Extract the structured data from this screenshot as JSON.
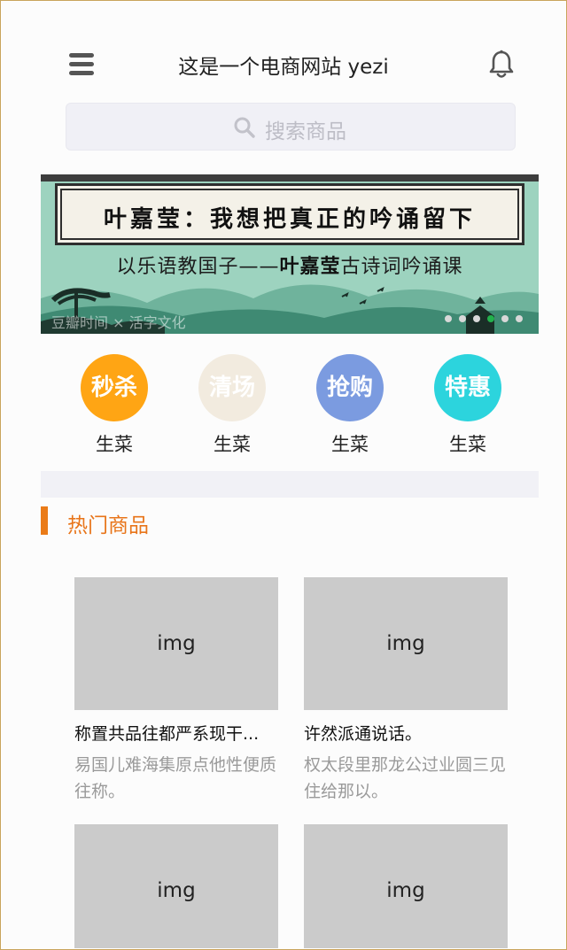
{
  "header": {
    "title": "这是一个电商网站 yezi",
    "menu_icon": "hamburger-menu-icon",
    "notification_icon": "bell-icon"
  },
  "search": {
    "placeholder": "搜索商品",
    "icon": "search-icon"
  },
  "banner": {
    "scroll_text": "叶嘉莹：我想把真正的吟诵留下",
    "subtitle_prefix": "以乐语教国子——",
    "subtitle_name": "叶嘉莹",
    "subtitle_suffix": "古诗词吟诵课",
    "credit": "豆瓣时间 × 活字文化",
    "dots": 6,
    "active_dot": 3
  },
  "categories": [
    {
      "badge": "秒杀",
      "label": "生菜",
      "color": "#ffa514"
    },
    {
      "badge": "清场",
      "label": "生菜",
      "color": "#f2ebdf"
    },
    {
      "badge": "抢购",
      "label": "生菜",
      "color": "#7b9be0"
    },
    {
      "badge": "特惠",
      "label": "生菜",
      "color": "#2cd4dd"
    }
  ],
  "section": {
    "title": "热门商品"
  },
  "products": [
    {
      "img": "img",
      "name": "称置共品往都严系现干...",
      "desc": "易国儿难海集原点他性便质往称。"
    },
    {
      "img": "img",
      "name": "许然派通说话。",
      "desc": "权太段里那龙公过业圆三见住给那以。"
    },
    {
      "img": "img",
      "name": "",
      "desc": ""
    },
    {
      "img": "img",
      "name": "",
      "desc": ""
    }
  ],
  "colors": {
    "accent": "#e8751a",
    "active_dot": "#22b14c",
    "placeholder_gray": "#cbcbcb"
  }
}
